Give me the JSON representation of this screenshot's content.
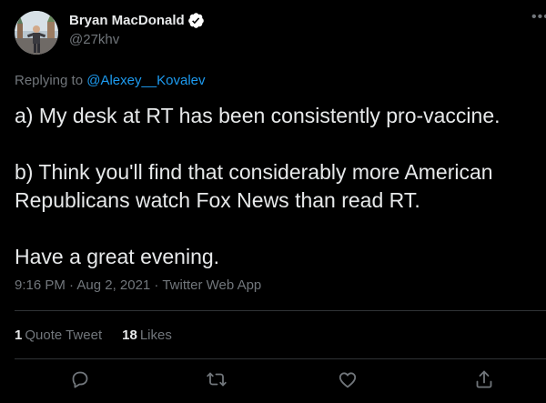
{
  "author": {
    "display_name": "Bryan MacDonald",
    "handle": "@27khv",
    "verified": true,
    "verified_color": "#ffffff"
  },
  "reply": {
    "prefix": "Replying to ",
    "mention": "@Alexey__Kovalev"
  },
  "tweet": {
    "paragraphs": [
      "a) My desk at RT has been consistently pro-vaccine.",
      "b) Think you'll find that considerably more American Republicans watch Fox News than read RT.",
      "Have a great evening."
    ]
  },
  "meta": {
    "text": "9:16 PM · Aug 2, 2021 · Twitter Web App"
  },
  "stats": {
    "quote_count": "1",
    "quote_label": "Quote Tweet",
    "like_count": "18",
    "like_label": "Likes"
  },
  "actions": [
    "reply-icon",
    "retweet-icon",
    "like-icon",
    "share-icon"
  ],
  "colors": {
    "background": "#000000",
    "text": "#e7e9ea",
    "muted": "#71767b",
    "link": "#1d9bf0",
    "divider": "#2f3336"
  }
}
